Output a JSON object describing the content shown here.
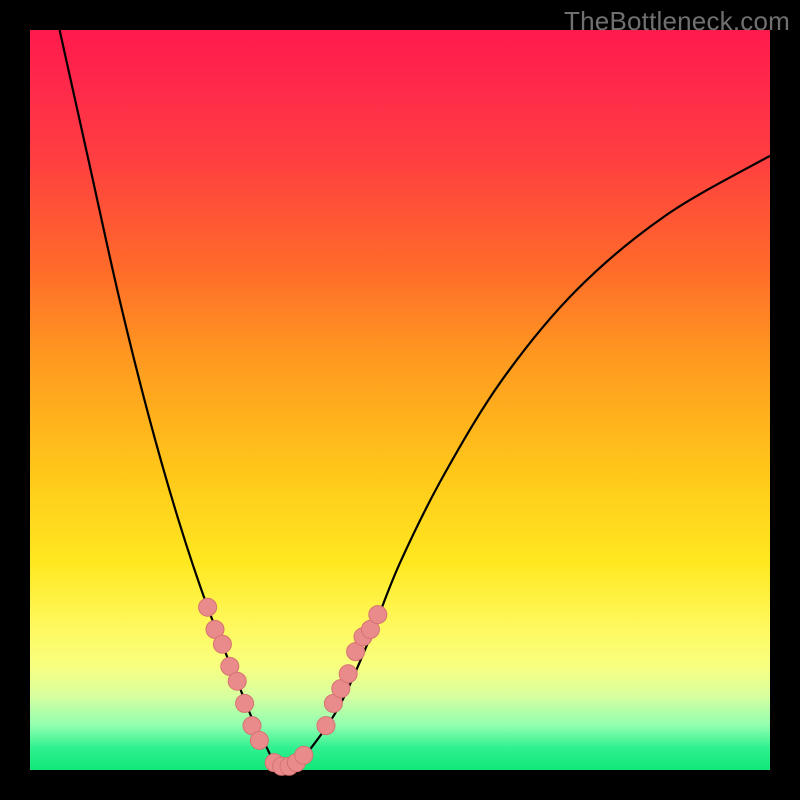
{
  "watermark": "TheBottleneck.com",
  "chart_data": {
    "type": "line",
    "title": "",
    "xlabel": "",
    "ylabel": "",
    "xlim": [
      0,
      100
    ],
    "ylim": [
      0,
      100
    ],
    "grid": false,
    "series": [
      {
        "name": "bottleneck-curve",
        "x": [
          4,
          8,
          12,
          16,
          20,
          24,
          28,
          30,
          32,
          33,
          34,
          35,
          38,
          42,
          46,
          50,
          56,
          64,
          74,
          86,
          100
        ],
        "y": [
          100,
          82,
          64,
          48,
          34,
          22,
          12,
          7,
          3,
          1,
          0,
          0,
          3,
          9,
          18,
          28,
          40,
          53,
          65,
          75,
          83
        ]
      }
    ],
    "markers": {
      "name": "highlight-points",
      "points": [
        {
          "x": 24,
          "y": 22
        },
        {
          "x": 25,
          "y": 19
        },
        {
          "x": 26,
          "y": 17
        },
        {
          "x": 27,
          "y": 14
        },
        {
          "x": 28,
          "y": 12
        },
        {
          "x": 29,
          "y": 9
        },
        {
          "x": 30,
          "y": 6
        },
        {
          "x": 31,
          "y": 4
        },
        {
          "x": 33,
          "y": 1
        },
        {
          "x": 34,
          "y": 0.5
        },
        {
          "x": 35,
          "y": 0.5
        },
        {
          "x": 36,
          "y": 1
        },
        {
          "x": 37,
          "y": 2
        },
        {
          "x": 40,
          "y": 6
        },
        {
          "x": 41,
          "y": 9
        },
        {
          "x": 42,
          "y": 11
        },
        {
          "x": 43,
          "y": 13
        },
        {
          "x": 44,
          "y": 16
        },
        {
          "x": 45,
          "y": 18
        },
        {
          "x": 46,
          "y": 19
        },
        {
          "x": 47,
          "y": 21
        }
      ]
    },
    "colors": {
      "curve": "#000000",
      "marker_fill": "#e98b8b",
      "marker_stroke": "#d67272"
    }
  }
}
